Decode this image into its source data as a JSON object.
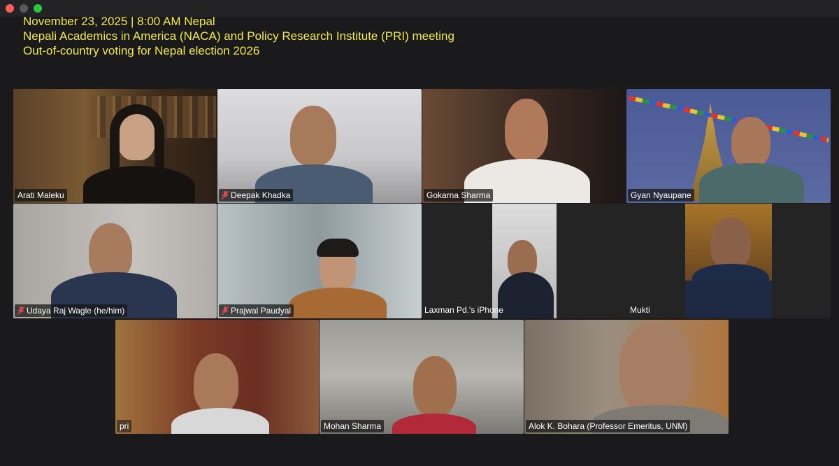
{
  "window": {
    "controls": [
      "close",
      "minimize",
      "maximize"
    ]
  },
  "heading": {
    "line1": "November 23, 2025 | 8:00 AM Nepal",
    "line2": "Nepali Academics in America (NACA) and Policy Research Institute (PRI) meeting",
    "line3": "Out-of-country voting for Nepal election 2026"
  },
  "participants": [
    {
      "name": "Arati Maleku",
      "muted": false,
      "speaking": true
    },
    {
      "name": "Deepak Khadka",
      "muted": true
    },
    {
      "name": "Gokarna Sharma",
      "muted": false
    },
    {
      "name": "Gyan Nyaupane",
      "muted": false
    },
    {
      "name": "Udaya Raj Wagle (he/him)",
      "muted": true
    },
    {
      "name": "Prajwal Paudyal",
      "muted": true
    },
    {
      "name": "Laxman Pd.'s iPhone",
      "muted": false
    },
    {
      "name": "Mukti",
      "muted": false
    },
    {
      "name": "pri",
      "muted": false
    },
    {
      "name": "Mohan Sharma",
      "muted": false
    },
    {
      "name": "Alok K. Bohara (Professor Emeritus, UNM)",
      "muted": false
    }
  ],
  "colors": {
    "heading": "#f2e84a",
    "active_border": "#3fd15a",
    "mute_icon": "#e5484d",
    "background": "#1a1a1c"
  }
}
